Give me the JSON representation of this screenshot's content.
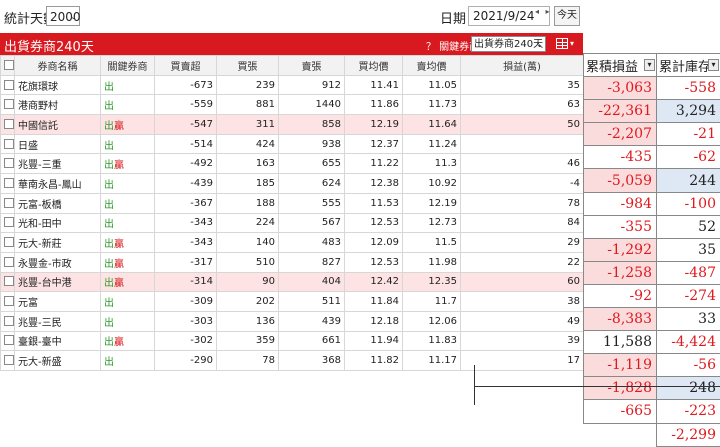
{
  "toolbar": {
    "days_label": "統計天數",
    "days_value": "2000",
    "date_label": "日期",
    "date_value": "2021/9/24",
    "nav_glyphs": "◂ ▸ ▾",
    "today_label": "今天"
  },
  "header": {
    "title": "出貨券商240天",
    "filter_label": "？ 關鍵券商:",
    "filter_value": "出貨券商240天"
  },
  "columns": [
    "券商名稱",
    "關鍵券商",
    "買賣超",
    "買張",
    "賣張",
    "買均價",
    "賣均價",
    "損益(萬)"
  ],
  "rows": [
    {
      "name": "花旗環球",
      "tag1": "出",
      "tag2": "",
      "net": "-673",
      "buy": "239",
      "sell": "912",
      "bavg": "11.41",
      "savg": "11.05",
      "pl": "35",
      "hl": false
    },
    {
      "name": "港商野村",
      "tag1": "出",
      "tag2": "",
      "net": "-559",
      "buy": "881",
      "sell": "1440",
      "bavg": "11.86",
      "savg": "11.73",
      "pl": "63",
      "hl": false
    },
    {
      "name": "中國信託",
      "tag1": "出",
      "tag2": "贏",
      "net": "-547",
      "buy": "311",
      "sell": "858",
      "bavg": "12.19",
      "savg": "11.64",
      "pl": "50",
      "hl": true
    },
    {
      "name": "日盛",
      "tag1": "出",
      "tag2": "",
      "net": "-514",
      "buy": "424",
      "sell": "938",
      "bavg": "12.37",
      "savg": "11.24",
      "pl": "",
      "hl": false
    },
    {
      "name": "兆豐-三重",
      "tag1": "出",
      "tag2": "贏",
      "net": "-492",
      "buy": "163",
      "sell": "655",
      "bavg": "11.22",
      "savg": "11.3",
      "pl": "46",
      "hl": false
    },
    {
      "name": "華南永昌-鳳山",
      "tag1": "出",
      "tag2": "",
      "net": "-439",
      "buy": "185",
      "sell": "624",
      "bavg": "12.38",
      "savg": "10.92",
      "pl": "-4",
      "hl": false
    },
    {
      "name": "元富-板橋",
      "tag1": "出",
      "tag2": "",
      "net": "-367",
      "buy": "188",
      "sell": "555",
      "bavg": "11.53",
      "savg": "12.19",
      "pl": "78",
      "hl": false
    },
    {
      "name": "光和-田中",
      "tag1": "出",
      "tag2": "",
      "net": "-343",
      "buy": "224",
      "sell": "567",
      "bavg": "12.53",
      "savg": "12.73",
      "pl": "84",
      "hl": false
    },
    {
      "name": "元大-新莊",
      "tag1": "出",
      "tag2": "贏",
      "net": "-343",
      "buy": "140",
      "sell": "483",
      "bavg": "12.09",
      "savg": "11.5",
      "pl": "29",
      "hl": false
    },
    {
      "name": "永豐金-市政",
      "tag1": "出",
      "tag2": "贏",
      "net": "-317",
      "buy": "510",
      "sell": "827",
      "bavg": "12.53",
      "savg": "11.98",
      "pl": "22",
      "hl": false
    },
    {
      "name": "兆豐-台中港",
      "tag1": "出",
      "tag2": "贏",
      "net": "-314",
      "buy": "90",
      "sell": "404",
      "bavg": "12.42",
      "savg": "12.35",
      "pl": "60",
      "hl": true
    },
    {
      "name": "元富",
      "tag1": "出",
      "tag2": "",
      "net": "-309",
      "buy": "202",
      "sell": "511",
      "bavg": "11.84",
      "savg": "11.7",
      "pl": "38",
      "hl": false
    },
    {
      "name": "兆豐-三民",
      "tag1": "出",
      "tag2": "",
      "net": "-303",
      "buy": "136",
      "sell": "439",
      "bavg": "12.18",
      "savg": "12.06",
      "pl": "49",
      "hl": false
    },
    {
      "name": "臺銀-臺中",
      "tag1": "出",
      "tag2": "贏",
      "net": "-302",
      "buy": "359",
      "sell": "661",
      "bavg": "11.94",
      "savg": "11.83",
      "pl": "39",
      "hl": false
    },
    {
      "name": "元大-新盛",
      "tag1": "出",
      "tag2": "",
      "net": "-290",
      "buy": "78",
      "sell": "368",
      "bavg": "11.82",
      "savg": "11.17",
      "pl": "17",
      "hl": false
    }
  ],
  "side_panel": {
    "headers": [
      "累積損益",
      "累計庫存"
    ],
    "rows": [
      {
        "a": "-3,063",
        "b": "-558",
        "a_bg": "pink",
        "b_bg": "",
        "a_neg": true,
        "b_neg": true
      },
      {
        "a": "-22,361",
        "b": "3,294",
        "a_bg": "pink",
        "b_bg": "blue",
        "a_neg": true,
        "b_neg": false
      },
      {
        "a": "-2,207",
        "b": "-21",
        "a_bg": "pink",
        "b_bg": "",
        "a_neg": true,
        "b_neg": true
      },
      {
        "a": "-435",
        "b": "-62",
        "a_bg": "",
        "b_bg": "",
        "a_neg": true,
        "b_neg": true
      },
      {
        "a": "-5,059",
        "b": "244",
        "a_bg": "pink",
        "b_bg": "blue",
        "a_neg": true,
        "b_neg": false
      },
      {
        "a": "-984",
        "b": "-100",
        "a_bg": "",
        "b_bg": "",
        "a_neg": true,
        "b_neg": true
      },
      {
        "a": "-355",
        "b": "52",
        "a_bg": "",
        "b_bg": "",
        "a_neg": true,
        "b_neg": false
      },
      {
        "a": "-1,292",
        "b": "35",
        "a_bg": "pink",
        "b_bg": "",
        "a_neg": true,
        "b_neg": false
      },
      {
        "a": "-1,258",
        "b": "-487",
        "a_bg": "pink",
        "b_bg": "",
        "a_neg": true,
        "b_neg": true
      },
      {
        "a": "-92",
        "b": "-274",
        "a_bg": "",
        "b_bg": "",
        "a_neg": true,
        "b_neg": true
      },
      {
        "a": "-8,383",
        "b": "33",
        "a_bg": "pink",
        "b_bg": "",
        "a_neg": true,
        "b_neg": false
      },
      {
        "a": "11,588",
        "b": "-4,424",
        "a_bg": "",
        "b_bg": "",
        "a_neg": false,
        "b_neg": true
      },
      {
        "a": "-1,119",
        "b": "-56",
        "a_bg": "pink",
        "b_bg": "",
        "a_neg": true,
        "b_neg": true
      },
      {
        "a": "-1,828",
        "b": "248",
        "a_bg": "pink",
        "b_bg": "blue",
        "a_neg": true,
        "b_neg": false
      },
      {
        "a": "-665",
        "b": "-223",
        "a_bg": "",
        "b_bg": "",
        "a_neg": true,
        "b_neg": true
      }
    ],
    "total": "-2,299"
  },
  "colors": {
    "header_red": "#d8191f",
    "out_green": "#2a9d2a",
    "win_red": "#d8191f",
    "neg_red": "#e0191f"
  }
}
